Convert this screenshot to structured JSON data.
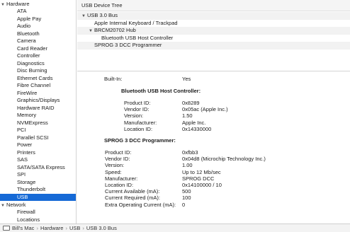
{
  "sidebar": {
    "hardware_label": "Hardware",
    "hardware_items": [
      "ATA",
      "Apple Pay",
      "Audio",
      "Bluetooth",
      "Camera",
      "Card Reader",
      "Controller",
      "Diagnostics",
      "Disc Burning",
      "Ethernet Cards",
      "Fibre Channel",
      "FireWire",
      "Graphics/Displays",
      "Hardware RAID",
      "Memory",
      "NVMExpress",
      "PCI",
      "Parallel SCSI",
      "Power",
      "Printers",
      "SAS",
      "SATA/SATA Express",
      "SPI",
      "Storage",
      "Thunderbolt",
      "USB"
    ],
    "selected": "USB",
    "network_label": "Network",
    "network_items": [
      "Firewall",
      "Locations"
    ]
  },
  "tree": {
    "header": "USB Device Tree",
    "rows": [
      {
        "label": "USB 3.0 Bus",
        "indent": 0,
        "expanded": true
      },
      {
        "label": "Apple Internal Keyboard / Trackpad",
        "indent": 1,
        "expanded": false
      },
      {
        "label": "BRCM20702 Hub",
        "indent": 1,
        "expanded": true
      },
      {
        "label": "Bluetooth USB Host Controller",
        "indent": 2,
        "expanded": false
      },
      {
        "label": "SPROG 3 DCC Programmer",
        "indent": 1,
        "expanded": false
      }
    ]
  },
  "details": {
    "builtin": {
      "key": "Built-In:",
      "value": "Yes"
    },
    "bt": {
      "heading": "Bluetooth USB Host Controller:",
      "fields": [
        {
          "key": "Product ID:",
          "value": "0x8289"
        },
        {
          "key": "Vendor ID:",
          "value": "0x05ac (Apple Inc.)"
        },
        {
          "key": "Version:",
          "value": "1.50"
        },
        {
          "key": "Manufacturer:",
          "value": "Apple Inc."
        },
        {
          "key": "Location ID:",
          "value": "0x14330000"
        }
      ]
    },
    "sprog": {
      "heading": "SPROG 3 DCC Programmer:",
      "fields": [
        {
          "key": "Product ID:",
          "value": "0xfbb3"
        },
        {
          "key": "Vendor ID:",
          "value": "0x04d8  (Microchip Technology Inc.)"
        },
        {
          "key": "Version:",
          "value": "1.00"
        },
        {
          "key": "Speed:",
          "value": "Up to 12 Mb/sec"
        },
        {
          "key": "Manufacturer:",
          "value": "SPROG DCC"
        },
        {
          "key": "Location ID:",
          "value": "0x14100000 / 10"
        },
        {
          "key": "Current Available (mA):",
          "value": "500"
        },
        {
          "key": "Current Required (mA):",
          "value": "100"
        },
        {
          "key": "Extra Operating Current (mA):",
          "value": "0"
        }
      ]
    }
  },
  "pathbar": {
    "items": [
      "Bill's Mac",
      "Hardware",
      "USB",
      "USB 3.0 Bus"
    ]
  }
}
